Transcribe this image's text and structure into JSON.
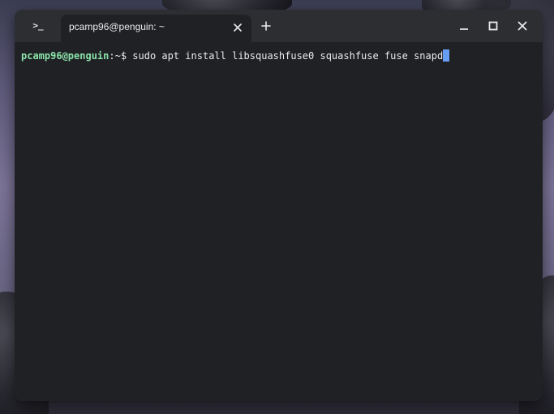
{
  "window": {
    "app_icon_text": ">_",
    "tab_title": "pcamp96@penguin: ~",
    "tab_close_icon": "close-icon",
    "new_tab_icon": "plus-icon",
    "minimize_icon": "minimize-icon",
    "maximize_icon": "maximize-icon",
    "close_icon": "close-icon"
  },
  "terminal": {
    "user_host": "pcamp96@penguin",
    "path_separator": ":~$",
    "command": " sudo apt install libsquashfuse0 squashfuse fuse snapd"
  },
  "colors": {
    "prompt_user": "#8ae1a9",
    "cursor": "#669df6",
    "terminal_bg": "#202124",
    "titlebar_bg": "#2d2e31"
  }
}
